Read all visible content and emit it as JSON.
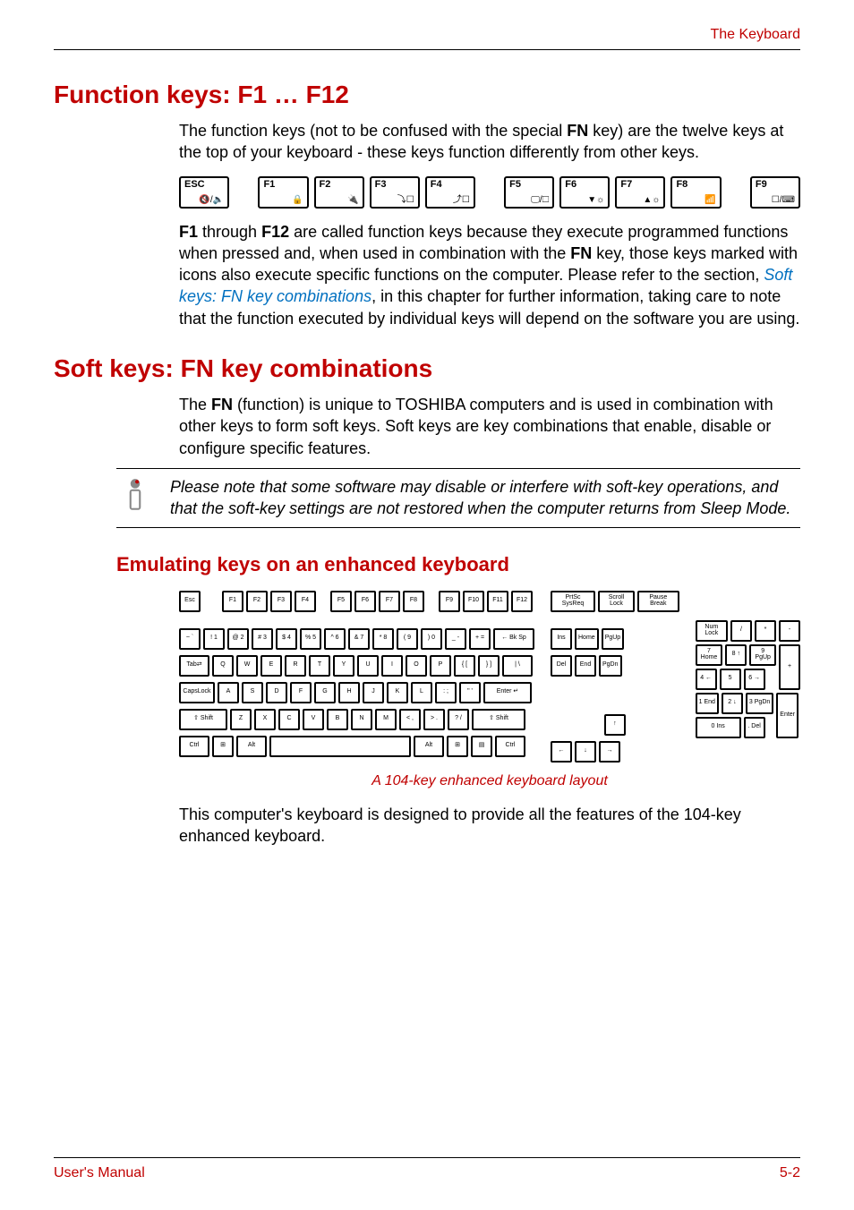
{
  "header": {
    "right": "The Keyboard"
  },
  "footer": {
    "left": "User's Manual",
    "right": "5-2"
  },
  "sec1": {
    "title": "Function keys: F1 … F12",
    "p1a": "The function keys (not to be confused with the special ",
    "p1b": "FN",
    "p1c": " key) are the twelve keys at the top of your keyboard - these keys function differently from other keys.",
    "p2a": "F1",
    "p2b": " through ",
    "p2c": "F12",
    "p2d": " are called function keys because they execute programmed functions when pressed and, when used in combination with the ",
    "p2e": "FN",
    "p2f": " key, those keys marked with icons also execute specific functions on the computer. Please refer to the section, ",
    "p2link": "Soft keys: FN key combinations",
    "p2g": ", in this chapter for further information, taking care to note that the function executed by individual keys will depend on the software you are using."
  },
  "fnrow": {
    "esc": {
      "label": "ESC",
      "icon": "🔇/🔈"
    },
    "f1": {
      "label": "F1",
      "icon": "🔒"
    },
    "f2": {
      "label": "F2",
      "icon": "🔌"
    },
    "f3": {
      "label": "F3",
      "icon": "⤵☐"
    },
    "f4": {
      "label": "F4",
      "icon": "⤴☐"
    },
    "f5": {
      "label": "F5",
      "icon": "🖵/☐"
    },
    "f6": {
      "label": "F6",
      "icon": "▼☼"
    },
    "f7": {
      "label": "F7",
      "icon": "▲☼"
    },
    "f8": {
      "label": "F8",
      "icon": "📶"
    },
    "f9": {
      "label": "F9",
      "icon": "☐/⌨"
    }
  },
  "sec2": {
    "title": "Soft keys: FN key combinations",
    "p1a": "The ",
    "p1b": "FN",
    "p1c": " (function) is unique to TOSHIBA computers and is used in combination with other keys to form soft keys. Soft keys are key combinations that enable, disable or configure specific features.",
    "note": "Please note that some software may disable or interfere with soft-key operations, and that the soft-key settings are not restored when the computer returns from Sleep Mode."
  },
  "sec3": {
    "title": "Emulating keys on an enhanced keyboard",
    "caption": "A 104-key enhanced keyboard layout",
    "p1": "This computer's keyboard is designed to provide all the features of the 104-key enhanced keyboard."
  },
  "kbd": {
    "row0": [
      "Esc",
      "F1",
      "F2",
      "F3",
      "F4",
      "F5",
      "F6",
      "F7",
      "F8",
      "F9",
      "F10",
      "F11",
      "F12"
    ],
    "row1": [
      "~ `",
      "! 1",
      "@ 2",
      "# 3",
      "$ 4",
      "% 5",
      "^ 6",
      "& 7",
      "* 8",
      "( 9",
      ") 0",
      "_ -",
      "+ =",
      "← Bk Sp"
    ],
    "row2": [
      "Tab⇄",
      "Q",
      "W",
      "E",
      "R",
      "T",
      "Y",
      "U",
      "I",
      "O",
      "P",
      "{ [",
      "} ]",
      "| \\"
    ],
    "row3": [
      "CapsLock",
      "A",
      "S",
      "D",
      "F",
      "G",
      "H",
      "J",
      "K",
      "L",
      ": ;",
      "\" '",
      "Enter ↵"
    ],
    "row4": [
      "⇧ Shift",
      "Z",
      "X",
      "C",
      "V",
      "B",
      "N",
      "M",
      "< ,",
      "> .",
      "? /",
      "⇧ Shift"
    ],
    "row5": [
      "Ctrl",
      "⊞",
      "Alt",
      " ",
      "Alt",
      "⊞",
      "▤",
      "Ctrl"
    ],
    "nav0": [
      "PrtSc SysReq",
      "Scroll Lock",
      "Pause Break"
    ],
    "nav1": [
      "Ins",
      "Home",
      "PgUp"
    ],
    "nav2": [
      "Del",
      "End",
      "PgDn"
    ],
    "arrowU": "↑",
    "arrows": [
      "←",
      "↓",
      "→"
    ],
    "numTop": [
      "Num Lock",
      "/",
      "*",
      "-"
    ],
    "num1": [
      "7 Home",
      "8 ↑",
      "9 PgUp"
    ],
    "num2": [
      "4 ←",
      "5",
      "6 →"
    ],
    "num3": [
      "1 End",
      "2 ↓",
      "3 PgDn"
    ],
    "num4": [
      "0 Ins",
      ". Del"
    ],
    "numPlus": "+",
    "numEnter": "Enter"
  }
}
